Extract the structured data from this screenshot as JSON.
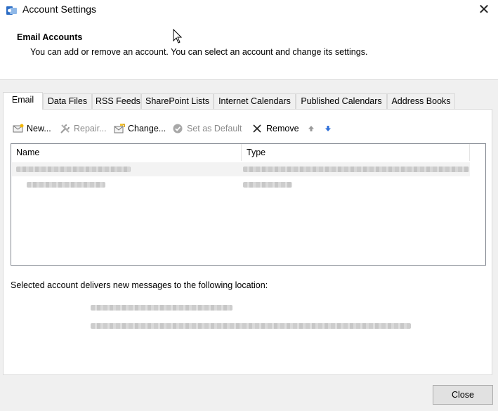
{
  "window": {
    "title": "Account Settings",
    "app_icon": "outlook-settings-icon",
    "close_glyph": "✕"
  },
  "header": {
    "title": "Email Accounts",
    "description": "You can add or remove an account. You can select an account and change its settings."
  },
  "tabs": [
    {
      "label": "Email",
      "active": true
    },
    {
      "label": "Data Files",
      "active": false
    },
    {
      "label": "RSS Feeds",
      "active": false
    },
    {
      "label": "SharePoint Lists",
      "active": false
    },
    {
      "label": "Internet Calendars",
      "active": false
    },
    {
      "label": "Published Calendars",
      "active": false
    },
    {
      "label": "Address Books",
      "active": false
    }
  ],
  "toolbar": {
    "new_label": "New...",
    "repair_label": "Repair...",
    "change_label": "Change...",
    "set_default_label": "Set as Default",
    "remove_label": "Remove"
  },
  "account_list": {
    "columns": [
      "Name",
      "Type"
    ]
  },
  "location": {
    "label": "Selected account delivers new messages to the following location:"
  },
  "footer": {
    "close_label": "Close"
  },
  "colors": {
    "window_bg": "#f0f0f0",
    "panel_bg": "#ffffff",
    "down_arrow": "#2f6fd8",
    "up_arrow": "#9a9a9a"
  }
}
